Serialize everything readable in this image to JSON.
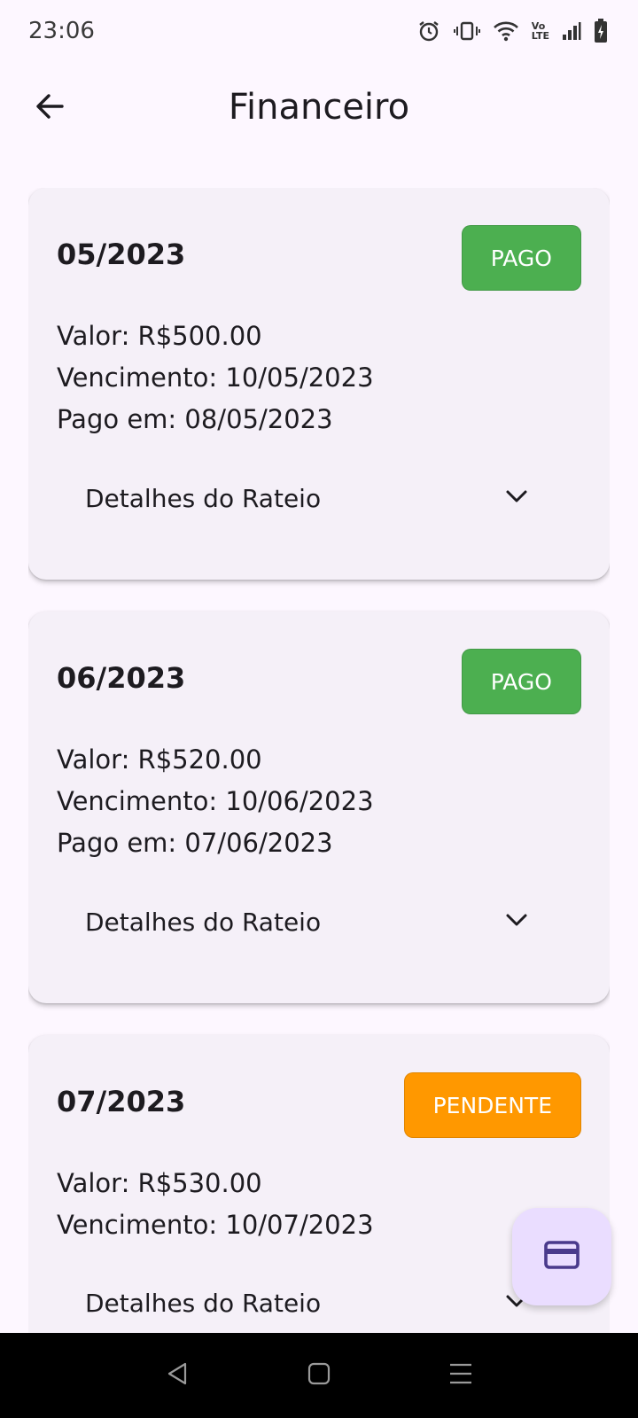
{
  "status_bar": {
    "time": "23:06",
    "icons": [
      "alarm-icon",
      "vibrate-icon",
      "wifi-icon",
      "volte-icon",
      "signal-icon",
      "battery-charging-icon"
    ],
    "volte_label_top": "Vo",
    "volte_label_bottom": "LTE"
  },
  "app_bar": {
    "title": "Financeiro",
    "back_icon": "arrow-back-icon"
  },
  "colors": {
    "paid": "#4caf50",
    "pending": "#ff9800",
    "fab_bg": "#eaddff",
    "fab_icon": "#4a3a8c"
  },
  "cards": [
    {
      "period": "05/2023",
      "status": "PAGO",
      "status_type": "paid",
      "value": "Valor: R$500.00",
      "due": "Vencimento: 10/05/2023",
      "paid_on": "Pago em: 08/05/2023",
      "details_label": "Detalhes do Rateio"
    },
    {
      "period": "06/2023",
      "status": "PAGO",
      "status_type": "paid",
      "value": "Valor: R$520.00",
      "due": "Vencimento: 10/06/2023",
      "paid_on": "Pago em: 07/06/2023",
      "details_label": "Detalhes do Rateio"
    },
    {
      "period": "07/2023",
      "status": "PENDENTE",
      "status_type": "pending",
      "value": "Valor: R$530.00",
      "due": "Vencimento: 10/07/2023",
      "details_label": "Detalhes do Rateio"
    }
  ],
  "fab": {
    "icon": "credit-card-icon"
  },
  "nav_bar": {
    "icons": [
      "back-triangle-icon",
      "home-square-icon",
      "recents-menu-icon"
    ]
  }
}
